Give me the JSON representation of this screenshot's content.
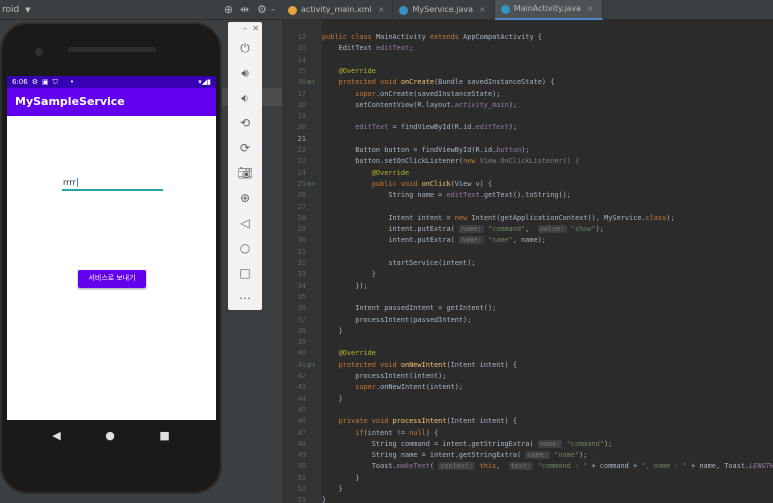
{
  "topbar": {
    "left_label": "roid",
    "tabs": [
      {
        "label": "activity_main.xml",
        "color": "#e8a33a",
        "active": false
      },
      {
        "label": "MyService.java",
        "color": "#3592c4",
        "active": false
      },
      {
        "label": "MainActivity.java",
        "color": "#3592c4",
        "active": true
      }
    ]
  },
  "emulator": {
    "status_time": "6:06",
    "app_title": "MySampleService",
    "edit_value": "rrrr",
    "button_label": "서비스로 보내기",
    "accent_color": "#6200ee",
    "toolbar_icons": [
      "power-icon",
      "volume-up-icon",
      "volume-down-icon",
      "rotate-left-icon",
      "rotate-right-icon",
      "camera-icon",
      "zoom-in-icon",
      "back-icon",
      "home-icon",
      "overview-icon",
      "more-icon"
    ]
  },
  "editor": {
    "current_line": "21",
    "lines": [
      {
        "n": "12",
        "t": [
          [
            "public class ",
            "k"
          ],
          [
            "MainActivity ",
            ""
          ],
          [
            "extends ",
            "k"
          ],
          [
            "AppCompatActivity {",
            ""
          ]
        ]
      },
      {
        "n": "13",
        "t": [
          [
            "    EditText ",
            ""
          ],
          [
            "editText",
            "v"
          ],
          [
            ";",
            ""
          ]
        ]
      },
      {
        "n": "14",
        "t": []
      },
      {
        "n": "15",
        "t": [
          [
            "    @Override",
            "a"
          ]
        ]
      },
      {
        "n": "16",
        "t": [
          [
            "    protected void ",
            "k"
          ],
          [
            "onCreate",
            "f"
          ],
          [
            "(Bundle savedInstanceState) {",
            ""
          ]
        ]
      },
      {
        "n": "17",
        "t": [
          [
            "        ",
            ""
          ],
          [
            "super",
            "k"
          ],
          [
            ".onCreate(savedInstanceState);",
            ""
          ]
        ]
      },
      {
        "n": "18",
        "t": [
          [
            "        setContentView(R.layout.",
            ""
          ],
          [
            "activity_main",
            "i"
          ],
          [
            ");",
            ""
          ]
        ]
      },
      {
        "n": "19",
        "t": []
      },
      {
        "n": "20",
        "t": [
          [
            "        ",
            ""
          ],
          [
            "editText",
            "v"
          ],
          [
            " = findViewById(R.id.",
            ""
          ],
          [
            "editText",
            "i"
          ],
          [
            ");",
            ""
          ]
        ]
      },
      {
        "n": "21",
        "t": []
      },
      {
        "n": "22",
        "t": [
          [
            "        Button button = findViewById(R.id.",
            ""
          ],
          [
            "button",
            "i"
          ],
          [
            ");",
            ""
          ]
        ]
      },
      {
        "n": "23",
        "t": [
          [
            "        button.setOnClickListener(",
            ""
          ],
          [
            "new ",
            "k"
          ],
          [
            "View.OnClickListener() {",
            "g"
          ]
        ]
      },
      {
        "n": "24",
        "t": [
          [
            "            @Override",
            "a"
          ]
        ]
      },
      {
        "n": "25",
        "t": [
          [
            "            public void ",
            "k"
          ],
          [
            "onClick",
            "f"
          ],
          [
            "(View v) {",
            ""
          ]
        ]
      },
      {
        "n": "26",
        "t": [
          [
            "                String name = ",
            ""
          ],
          [
            "editText",
            "v"
          ],
          [
            ".getText().toString();",
            ""
          ]
        ]
      },
      {
        "n": "27",
        "t": []
      },
      {
        "n": "28",
        "t": [
          [
            "                Intent intent = ",
            ""
          ],
          [
            "new ",
            "k"
          ],
          [
            "Intent(getApplicationContext(), MyService.",
            ""
          ],
          [
            "class",
            "k"
          ],
          [
            ");",
            ""
          ]
        ]
      },
      {
        "n": "29",
        "t": [
          [
            "                intent.putExtra( ",
            ""
          ],
          [
            "name:",
            "h"
          ],
          [
            " ",
            ""
          ],
          [
            "\"command\"",
            "s"
          ],
          [
            ",  ",
            ""
          ],
          [
            "value:",
            "h"
          ],
          [
            " ",
            ""
          ],
          [
            "\"show\"",
            "s"
          ],
          [
            ");",
            ""
          ]
        ]
      },
      {
        "n": "30",
        "t": [
          [
            "                intent.putExtra( ",
            ""
          ],
          [
            "name:",
            "h"
          ],
          [
            " ",
            ""
          ],
          [
            "\"name\"",
            "s"
          ],
          [
            ", name);",
            ""
          ]
        ]
      },
      {
        "n": "31",
        "t": []
      },
      {
        "n": "32",
        "t": [
          [
            "                startService(intent);",
            ""
          ]
        ]
      },
      {
        "n": "33",
        "t": [
          [
            "            }",
            ""
          ]
        ]
      },
      {
        "n": "34",
        "t": [
          [
            "        });",
            ""
          ]
        ]
      },
      {
        "n": "35",
        "t": []
      },
      {
        "n": "36",
        "t": [
          [
            "        Intent passedIntent = getIntent();",
            ""
          ]
        ]
      },
      {
        "n": "37",
        "t": [
          [
            "        processIntent(passedIntent);",
            ""
          ]
        ]
      },
      {
        "n": "38",
        "t": [
          [
            "    }",
            ""
          ]
        ]
      },
      {
        "n": "39",
        "t": []
      },
      {
        "n": "40",
        "t": [
          [
            "    @Override",
            "a"
          ]
        ]
      },
      {
        "n": "41",
        "t": [
          [
            "    protected void ",
            "k"
          ],
          [
            "onNewIntent",
            "f"
          ],
          [
            "(Intent intent) {",
            ""
          ]
        ]
      },
      {
        "n": "42",
        "t": [
          [
            "        processIntent(intent);",
            ""
          ]
        ]
      },
      {
        "n": "43",
        "t": [
          [
            "        ",
            ""
          ],
          [
            "super",
            "k"
          ],
          [
            ".onNewIntent(intent);",
            ""
          ]
        ]
      },
      {
        "n": "44",
        "t": [
          [
            "    }",
            ""
          ]
        ]
      },
      {
        "n": "45",
        "t": []
      },
      {
        "n": "46",
        "t": [
          [
            "    private void ",
            "k"
          ],
          [
            "processIntent",
            "f"
          ],
          [
            "(Intent intent) {",
            ""
          ]
        ]
      },
      {
        "n": "47",
        "t": [
          [
            "        ",
            ""
          ],
          [
            "if",
            "k"
          ],
          [
            "(intent != ",
            ""
          ],
          [
            "null",
            "k"
          ],
          [
            ") {",
            ""
          ]
        ]
      },
      {
        "n": "48",
        "t": [
          [
            "            String command = intent.getStringExtra( ",
            ""
          ],
          [
            "name:",
            "h"
          ],
          [
            " ",
            ""
          ],
          [
            "\"command\"",
            "s"
          ],
          [
            ");",
            ""
          ]
        ]
      },
      {
        "n": "49",
        "t": [
          [
            "            String name = intent.getStringExtra( ",
            ""
          ],
          [
            "name:",
            "h"
          ],
          [
            " ",
            ""
          ],
          [
            "\"name\"",
            "s"
          ],
          [
            ");",
            ""
          ]
        ]
      },
      {
        "n": "50",
        "t": [
          [
            "            Toast.",
            ""
          ],
          [
            "makeText",
            "i"
          ],
          [
            "( ",
            ""
          ],
          [
            "context:",
            "h"
          ],
          [
            " ",
            ""
          ],
          [
            "this",
            "k"
          ],
          [
            ",  ",
            ""
          ],
          [
            "text:",
            "h"
          ],
          [
            " ",
            ""
          ],
          [
            "\"command : \"",
            "s"
          ],
          [
            " + command + ",
            ""
          ],
          [
            "\", name : \"",
            "s"
          ],
          [
            " + name, Toast.",
            ""
          ],
          [
            "LENGTH_LONG",
            "i"
          ],
          [
            ").show()",
            ""
          ]
        ]
      },
      {
        "n": "51",
        "t": [
          [
            "        }",
            ""
          ]
        ]
      },
      {
        "n": "52",
        "t": [
          [
            "    }",
            ""
          ]
        ]
      },
      {
        "n": "53",
        "t": [
          [
            "}",
            ""
          ]
        ]
      }
    ],
    "override_markers": [
      "16",
      "25",
      "41"
    ]
  }
}
